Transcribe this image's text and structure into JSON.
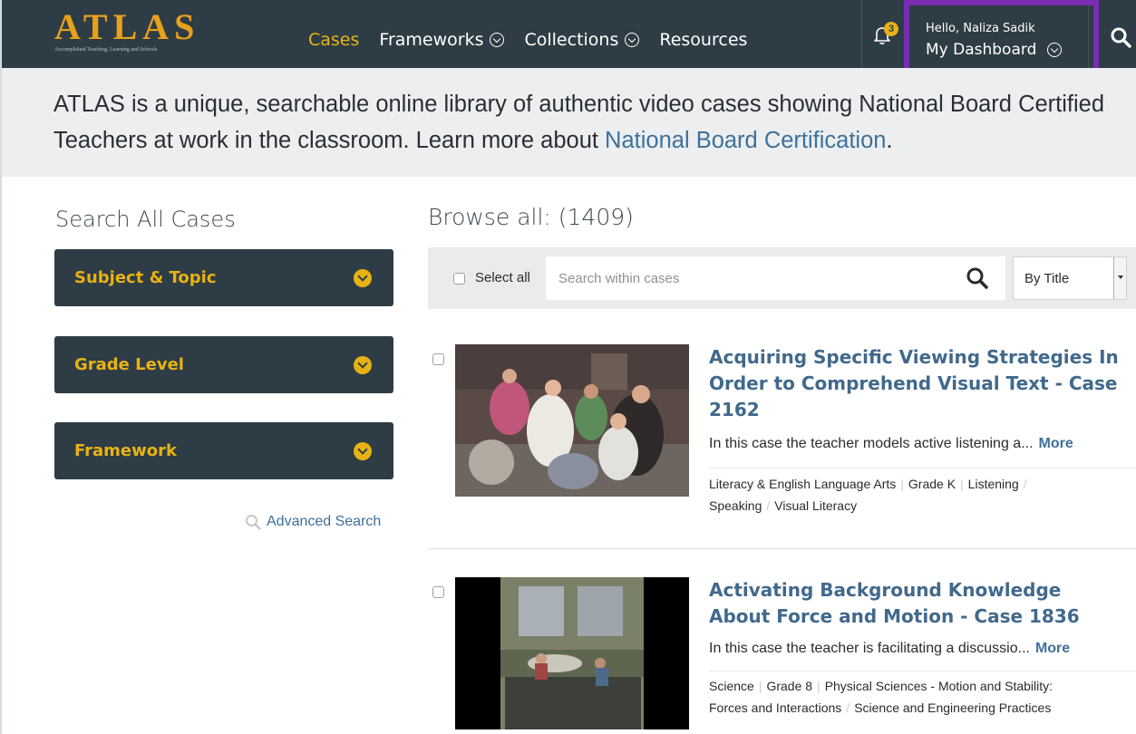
{
  "header": {
    "logo_text": "ATLAS",
    "logo_tagline": "Accomplished Teaching, Learning and Schools",
    "nav": [
      {
        "label": "Cases",
        "dropdown": false,
        "active": true
      },
      {
        "label": "Frameworks",
        "dropdown": true,
        "active": false
      },
      {
        "label": "Collections",
        "dropdown": true,
        "active": false
      },
      {
        "label": "Resources",
        "dropdown": false,
        "active": false
      }
    ],
    "notifications_count": "3",
    "greeting": "Hello, Naliza Sadik",
    "dashboard_label": "My Dashboard",
    "icons": {
      "notifications": "bell-icon",
      "search": "search-icon"
    }
  },
  "banner": {
    "text": "ATLAS is a unique, searchable online library of authentic video cases showing National Board Certified Teachers at work in the classroom. Learn more about ",
    "link": "National Board Certification",
    "suffix": "."
  },
  "sidebar": {
    "title": "Search All Cases",
    "facets": [
      "Subject & Topic",
      "Grade Level",
      "Framework"
    ],
    "advanced_search": "Advanced Search"
  },
  "browse": {
    "title": "Browse all: (1409)",
    "select_all": "Select all",
    "search_placeholder": "Search within cases",
    "sort_value": "By Title",
    "cases": [
      {
        "title": "Acquiring Specific Viewing Strategies In Order to Comprehend Visual Text - Case 2162",
        "description": "In this case the teacher models active listening a...",
        "more": "More",
        "tags_line1": [
          "Literacy & English Language Arts",
          "Grade K",
          "Listening"
        ],
        "tags_line2": [
          "Speaking",
          "Visual Literacy"
        ]
      },
      {
        "title": "Activating Background Knowledge About Force and Motion - Case 1836",
        "description": "In this case the teacher is facilitating a discussio...",
        "more": "More",
        "tags_line1": [
          "Science",
          "Grade 8",
          "Physical Sciences - Motion and Stability:"
        ],
        "tags_line2": [
          "Forces and Interactions",
          "Science and Engineering Practices"
        ]
      }
    ]
  },
  "colors": {
    "nav_bg": "#2e3d45",
    "accent_gold": "#e8b214",
    "link_blue": "#41698c",
    "highlight_purple": "#7a2db3",
    "banner_bg": "#eceef0"
  }
}
